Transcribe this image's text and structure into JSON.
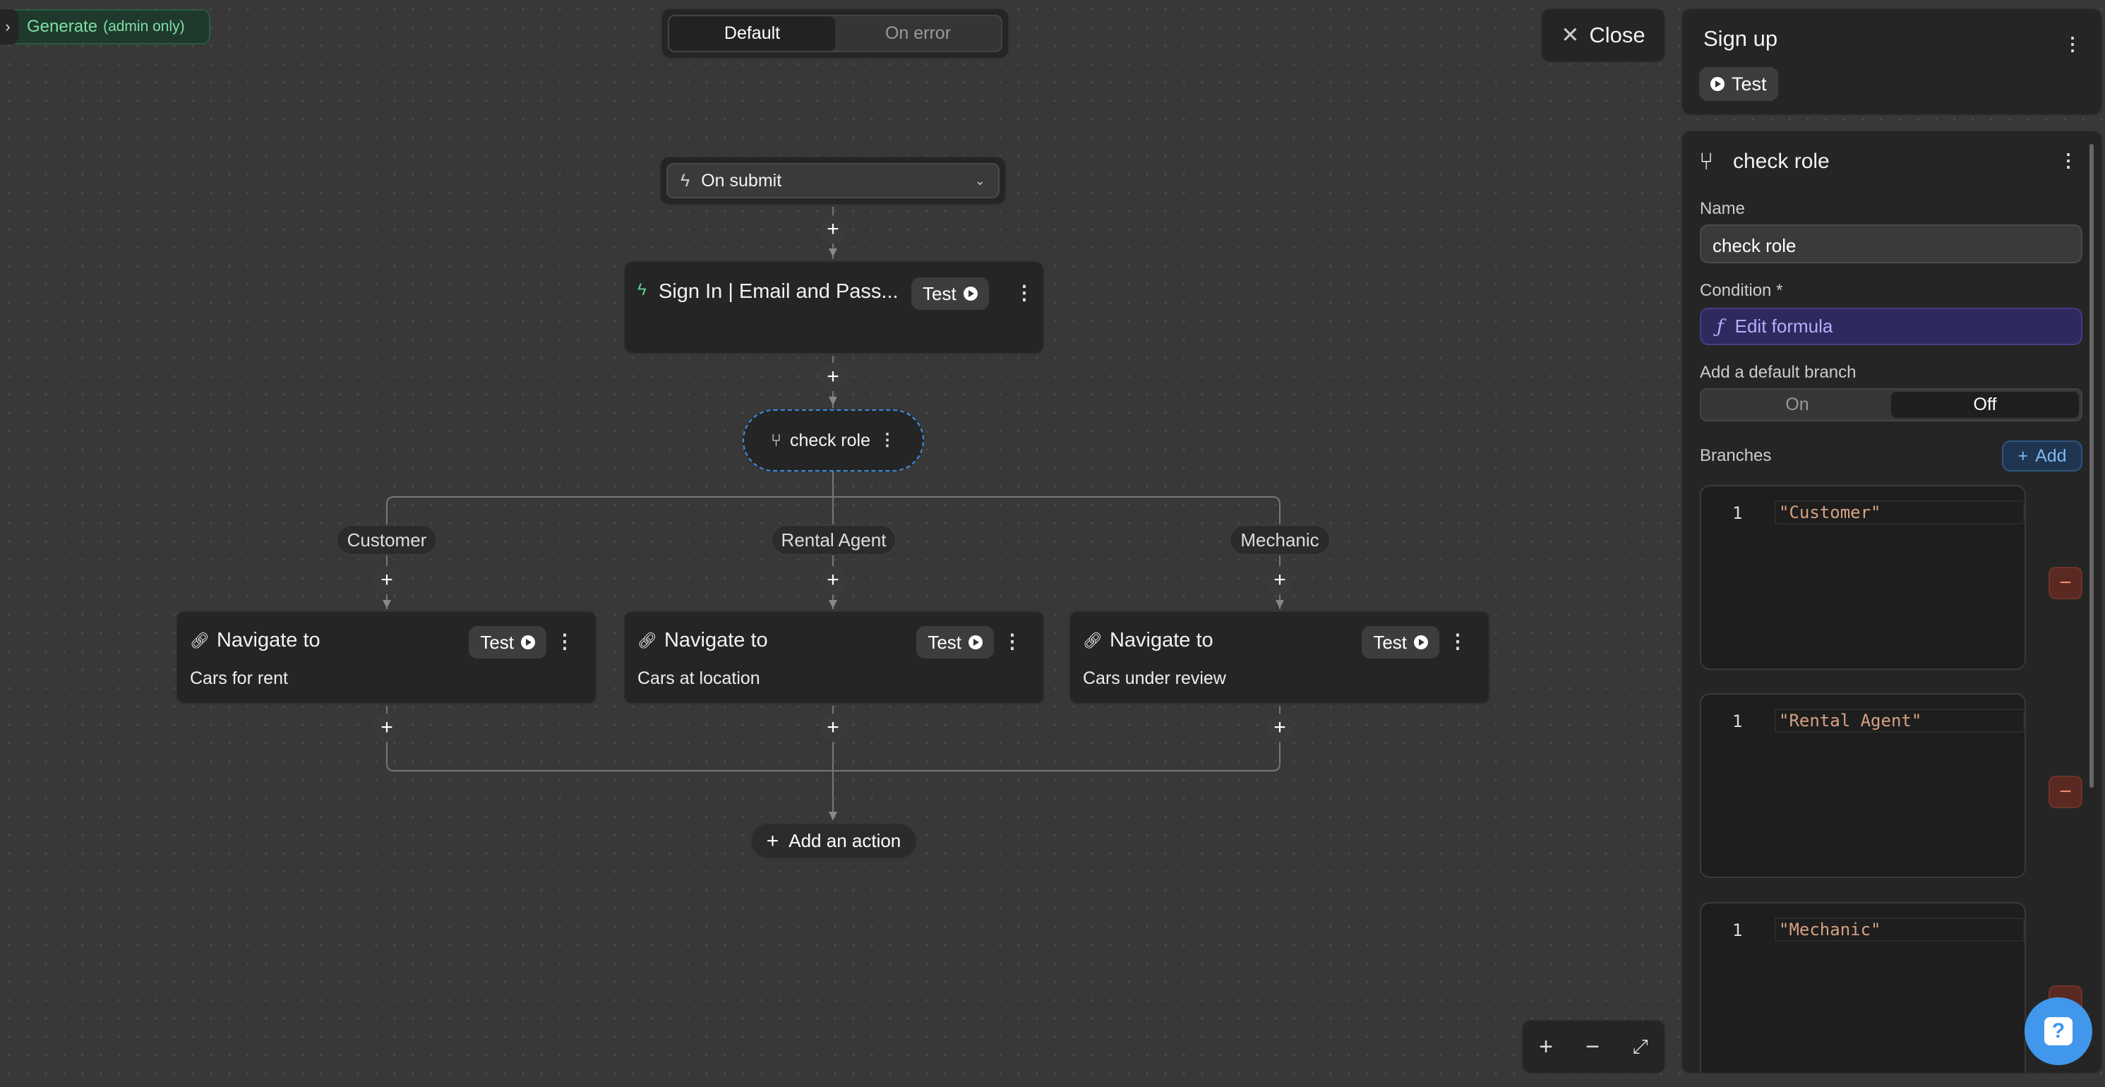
{
  "generate": {
    "label": "Generate",
    "note": "(admin only)"
  },
  "mode_toggle": {
    "options": [
      "Default",
      "On error"
    ],
    "selected": "Default"
  },
  "trigger": {
    "label": "On submit"
  },
  "steps": {
    "sign_in": {
      "title": "Sign In | Email and Pass...",
      "test": "Test"
    },
    "condition": {
      "title": "check role"
    },
    "branches": [
      "Customer",
      "Rental Agent",
      "Mechanic"
    ],
    "navigate": [
      {
        "title": "Navigate to",
        "target": "Cars for rent",
        "test": "Test"
      },
      {
        "title": "Navigate to",
        "target": "Cars at location",
        "test": "Test"
      },
      {
        "title": "Navigate to",
        "target": "Cars under review",
        "test": "Test"
      }
    ],
    "add_action": "Add an action"
  },
  "close": {
    "label": "Close"
  },
  "workflow": {
    "title": "Sign up",
    "test": "Test"
  },
  "inspector": {
    "title": "check role",
    "name_label": "Name",
    "name_value": "check role",
    "condition_label": "Condition *",
    "formula_button": "Edit formula",
    "default_branch_label": "Add a default branch",
    "default_branch_options": [
      "On",
      "Off"
    ],
    "default_branch_selected": "Off",
    "branches_label": "Branches",
    "add_label": "Add",
    "branch_editors": [
      {
        "line": "1",
        "code": "\"Customer\""
      },
      {
        "line": "1",
        "code": "\"Rental Agent\""
      },
      {
        "line": "1",
        "code": "\"Mechanic\""
      }
    ]
  },
  "colors": {
    "accent_blue": "#3b8fe0",
    "formula_bg": "#2f2a5e",
    "generate_green": "#7ee0a8",
    "remove_red": "#5a2a22"
  }
}
